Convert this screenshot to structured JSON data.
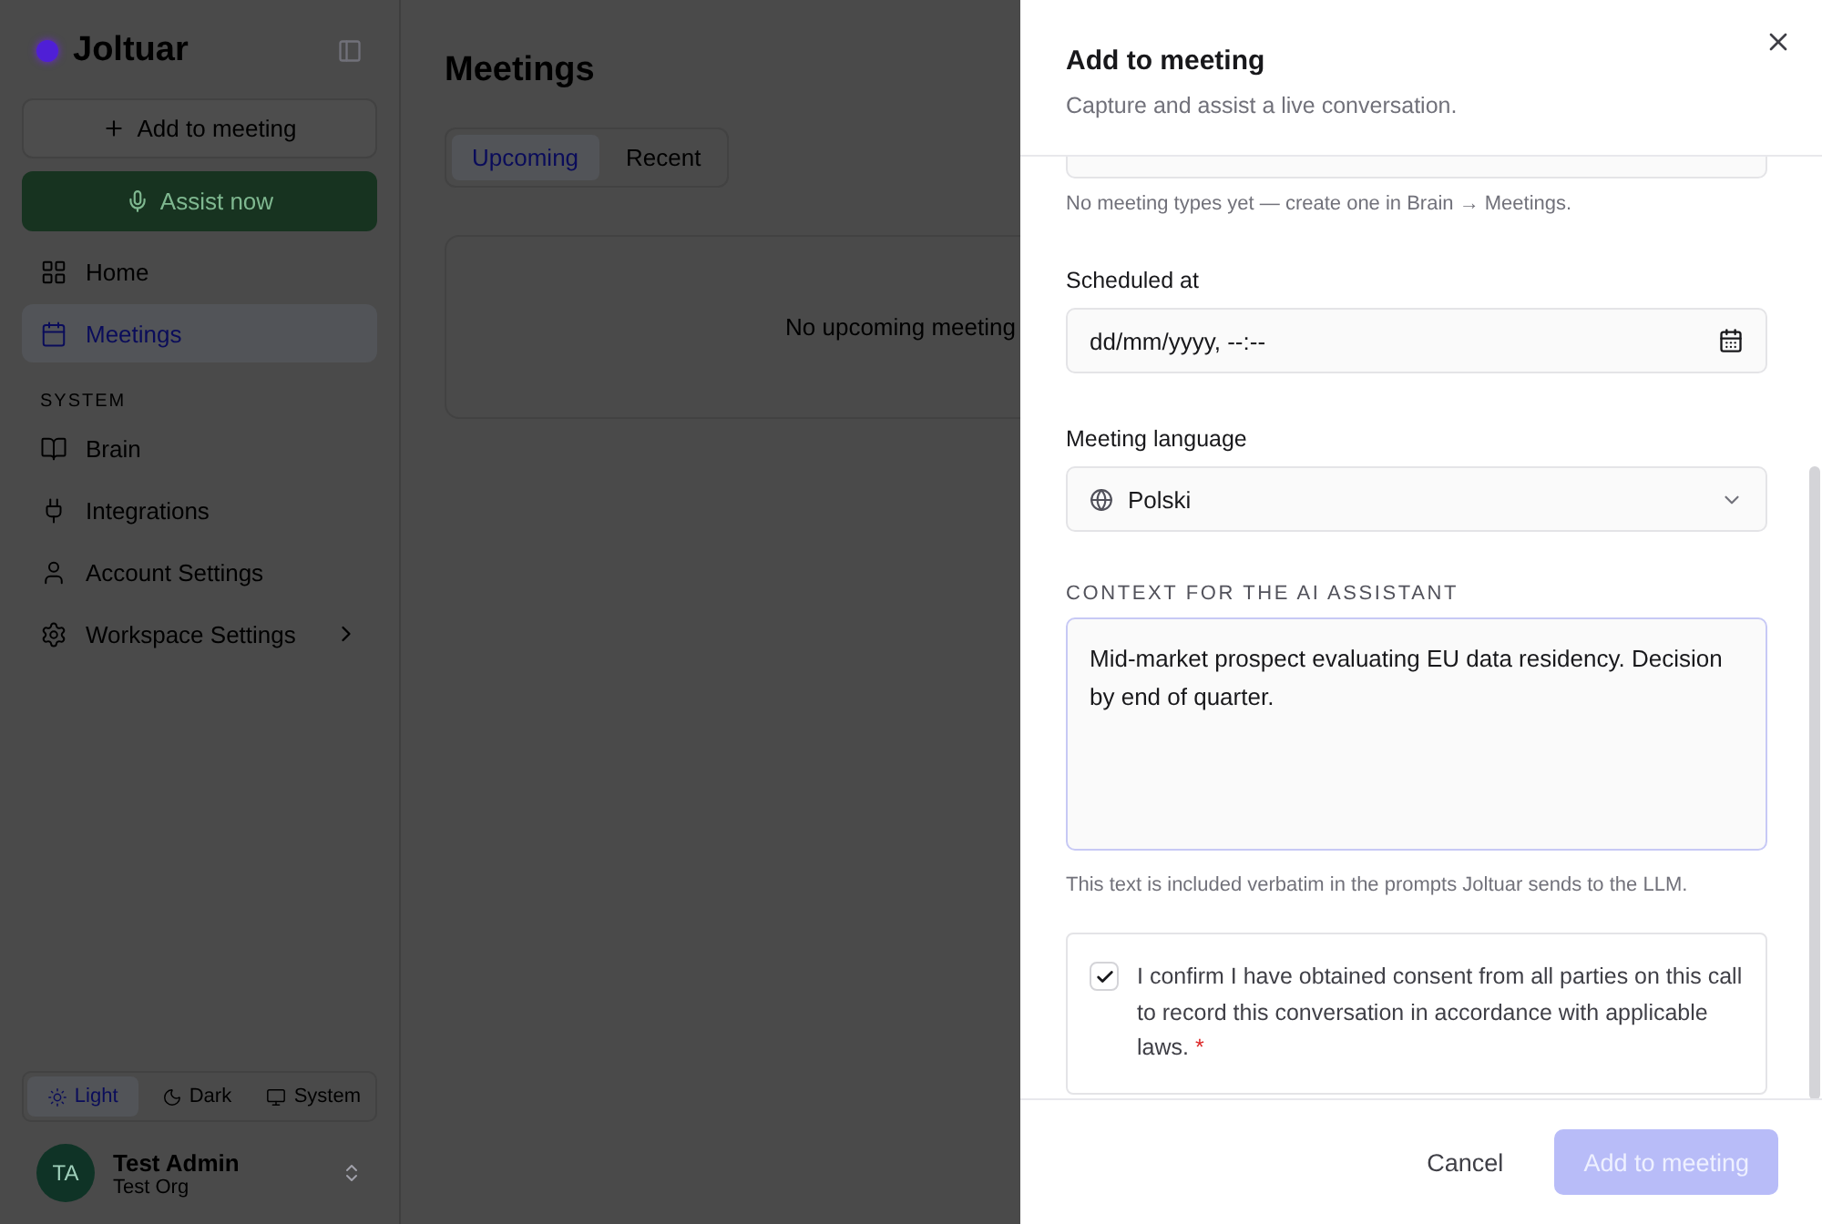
{
  "sidebar": {
    "brand": "Joltuar",
    "add_button": "Add to meeting",
    "assist_button": "Assist now",
    "nav": [
      {
        "kind": "home",
        "label": "Home",
        "selected": false
      },
      {
        "kind": "calendar",
        "label": "Meetings",
        "selected": true
      }
    ],
    "section_title": "SYSTEM",
    "system_nav": [
      {
        "kind": "book",
        "label": "Brain",
        "has_submenu": false
      },
      {
        "kind": "plug",
        "label": "Integrations",
        "has_submenu": false
      },
      {
        "kind": "user",
        "label": "Account Settings",
        "has_submenu": false
      },
      {
        "kind": "gear",
        "label": "Workspace Settings",
        "has_submenu": true
      }
    ],
    "themes": [
      {
        "kind": "sun",
        "label": "Light",
        "selected": true
      },
      {
        "kind": "moon",
        "label": "Dark",
        "selected": false
      },
      {
        "kind": "monitor",
        "label": "System",
        "selected": false
      }
    ],
    "user": {
      "initials": "TA",
      "name": "Test Admin",
      "org": "Test Org"
    }
  },
  "main": {
    "title": "Meetings",
    "tabs": [
      {
        "label": "Upcoming",
        "selected": true
      },
      {
        "label": "Recent",
        "selected": false
      }
    ],
    "empty_text": "No upcoming meeting"
  },
  "drawer": {
    "title": "Add to meeting",
    "subtitle": "Capture and assist a live conversation.",
    "meeting_type_hint": "No meeting types yet — create one in Brain → Meetings.",
    "scheduled_label": "Scheduled at",
    "scheduled_placeholder": "dd/mm/yyyy, --:--",
    "language_label": "Meeting language",
    "language_value": "Polski",
    "context_label": "CONTEXT FOR THE AI ASSISTANT",
    "context_value": "Mid-market prospect evaluating EU data residency. Decision by end of quarter.",
    "context_hint": "This text is included verbatim in the prompts Joltuar sends to the LLM.",
    "consent": {
      "text": "I confirm I have obtained consent from all parties on this call to record this conversation in accordance with applicable laws.",
      "required_mark": "*",
      "checked": true
    },
    "cancel_button": "Cancel",
    "submit_button": {
      "label": "Add to meeting",
      "disabled": true
    }
  }
}
